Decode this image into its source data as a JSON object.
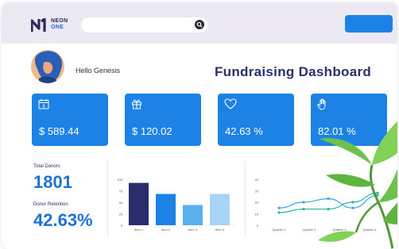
{
  "brand": {
    "line1": "NEON",
    "line2": "ONE"
  },
  "search": {
    "placeholder": ""
  },
  "user": {
    "greeting": "Hello Genesis"
  },
  "page": {
    "title": "Fundraising Dashboard"
  },
  "cards": [
    {
      "icon": "calendar-icon",
      "value": "$ 589.44"
    },
    {
      "icon": "gift-icon",
      "value": "$ 120.02"
    },
    {
      "icon": "heart-icon",
      "value": "42.63 %"
    },
    {
      "icon": "hand-icon",
      "value": "82.01 %"
    }
  ],
  "stats": {
    "total_donors_label": "Total Donors",
    "total_donors_value": "1801",
    "retention_label": "Donor Retention",
    "retention_value": "42.63%"
  },
  "colors": {
    "accent": "#1d82e6",
    "header_bg": "#ece9f3",
    "title": "#2b2f6b",
    "bar_1": "#2a2d6b",
    "bar_2": "#1d82e6",
    "bar_3": "#5ab0ec",
    "bar_4": "#a8d5f7",
    "line_1": "#3aa3e6",
    "line_2": "#1fb89a",
    "plant": "#6cc24a"
  },
  "chart_data": [
    {
      "type": "bar",
      "categories": [
        "Item 1",
        "Item 2",
        "Item 3",
        "Item 4"
      ],
      "values": [
        92,
        68,
        44,
        68
      ],
      "ylim": [
        0,
        100
      ],
      "yticks": [
        0,
        25,
        50,
        75,
        100
      ],
      "title": "",
      "xlabel": "",
      "ylabel": ""
    },
    {
      "type": "line",
      "categories": [
        "Quarter 1",
        "Quarter 2",
        "Quarter 3",
        "Quarter 4"
      ],
      "ylim": [
        0,
        40
      ],
      "yticks": [
        0,
        10,
        20,
        30,
        40
      ],
      "series": [
        {
          "values": [
            15,
            20,
            23,
            15,
            26
          ]
        },
        {
          "values": [
            11,
            14,
            14,
            20,
            28
          ]
        }
      ],
      "title": "",
      "xlabel": "",
      "ylabel": ""
    }
  ]
}
